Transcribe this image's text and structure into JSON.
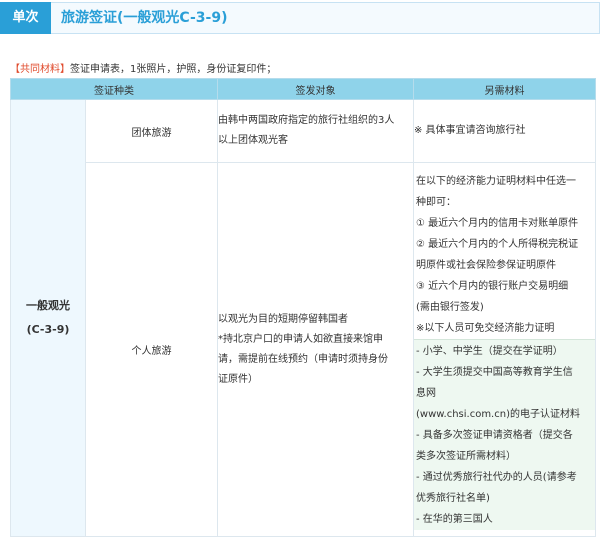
{
  "header": {
    "tag": "单次",
    "title": "旅游签证(一般观光C-3-9)"
  },
  "common": {
    "label": "【共同材料】",
    "text": "签证申请表，1张照片，护照，身份证复印件；"
  },
  "table": {
    "headers": [
      "签证种类",
      "签发对象",
      "另需材料"
    ],
    "category": [
      "一般观光",
      "(C-3-9)"
    ],
    "rows": [
      {
        "type": "团体旅游",
        "target": [
          "由韩中两国政府指定的旅行社组织的3人",
          "以上团体观光客"
        ],
        "materials": [
          "※ 具体事宜请咨询旅行社"
        ]
      },
      {
        "type": "个人旅游",
        "target": [
          "以观光为目的短期停留韩国者",
          "*持北京户口的申请人如欲直接来馆申",
          "请，需提前在线预约（申请时须持身份",
          "证原件）"
        ],
        "materials": [
          "在以下的经济能力证明材料中任选一",
          "种即可：",
          "① 最近六个月内的信用卡对账单原件",
          "② 最近六个月内的个人所得税完税证",
          "明原件或社会保险参保证明原件",
          "③ 近六个月内的银行账户交易明细",
          "(需由银行签发)",
          "※以下人员可免交经济能力证明"
        ],
        "exempt": [
          "- 小学、中学生（提交在学证明）",
          "- 大学生须提交中国高等教育学生信",
          "息网",
          "(www.chsi.com.cn)的电子认证材料",
          " - 具备多次签证申请资格者（提交各",
          "类多次签证所需材料）",
          " - 通过优秀旅行社代办的人员(请参考",
          "优秀旅行社名单)",
          " - 在华的第三国人"
        ]
      }
    ]
  },
  "colors": {
    "accent": "#2a9fd7",
    "header_bg": "#8fd3ea",
    "highlight_label": "#e04b2d",
    "exempt_bg": "#eef8f1"
  }
}
